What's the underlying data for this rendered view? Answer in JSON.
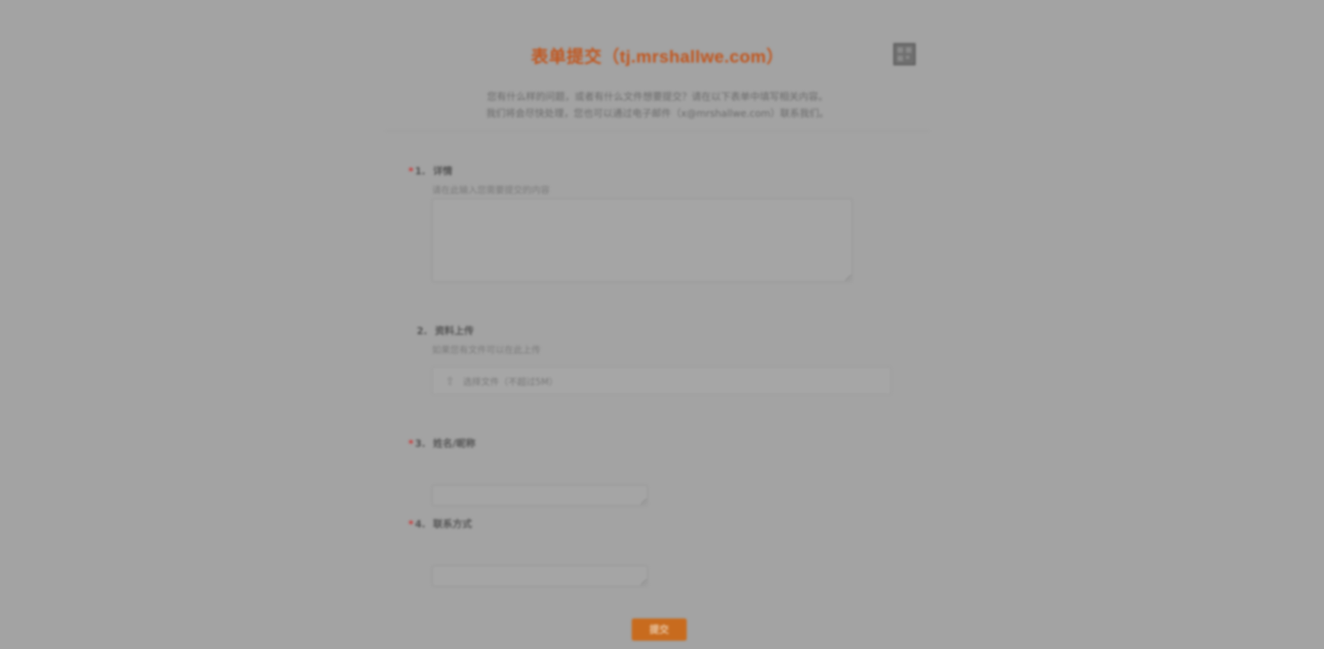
{
  "form": {
    "title": "表单提交（tj.mrshallwe.com）",
    "description_lines": [
      "您有什么样的问题，或者有什么文件想要提交？请在以下表单中填写相关内容。",
      "我们将会尽快处理，您也可以通过电子邮件（x@mrshallwe.com）联系我们。"
    ],
    "questions": [
      {
        "number": "1.",
        "required": "*",
        "label": "详情",
        "hint": "请在此输入您需要提交的内容"
      },
      {
        "number": "2.",
        "required": "",
        "label": "资料上传",
        "hint": "如果您有文件可以在此上传",
        "upload_label": "选择文件（不超过5M）"
      },
      {
        "number": "3.",
        "required": "*",
        "label": "姓名/昵称"
      },
      {
        "number": "4.",
        "required": "*",
        "label": "联系方式"
      }
    ],
    "submit_label": "提交"
  },
  "icons": {
    "qr": "qr-code-icon",
    "upload": "upload-icon"
  },
  "colors": {
    "title": "#c1561e",
    "submit": "#c86b1e",
    "overlay": "#a3a3a3"
  }
}
